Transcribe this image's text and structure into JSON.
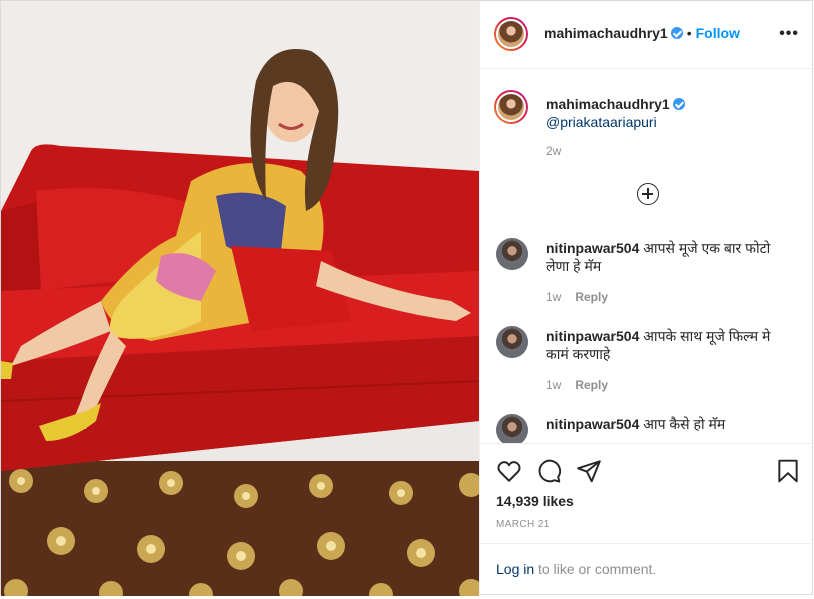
{
  "post": {
    "username": "mahimachaudhry1",
    "verified": true,
    "follow_separator": "•",
    "follow_label": "Follow",
    "more_label": "•••"
  },
  "caption": {
    "username": "mahimachaudhry1",
    "mention": "@priakataariapuri",
    "time": "2w"
  },
  "comments": [
    {
      "username": "nitinpawar504",
      "text": "आपसे मूजे एक बार फोटो लेणा हे मॅम",
      "time": "1w",
      "reply_label": "Reply"
    },
    {
      "username": "nitinpawar504",
      "text": "आपके साथ मूजे फिल्म मे कामं करणाहे",
      "time": "1w",
      "reply_label": "Reply"
    },
    {
      "username": "nitinpawar504",
      "text": "आप कैसे हो मॅम",
      "time": "",
      "reply_label": ""
    }
  ],
  "actions": {
    "icons": [
      "heart-icon",
      "comment-icon",
      "share-icon",
      "bookmark-icon"
    ]
  },
  "likes_label": "14,939 likes",
  "date_label": "MARCH 21",
  "login_prompt": {
    "link": "Log in",
    "rest": " to like or comment."
  },
  "colors": {
    "accent": "#0095f6",
    "verified": "#3897f0",
    "sofa": "#d81e1e",
    "carpet": "#5a2f1a"
  }
}
